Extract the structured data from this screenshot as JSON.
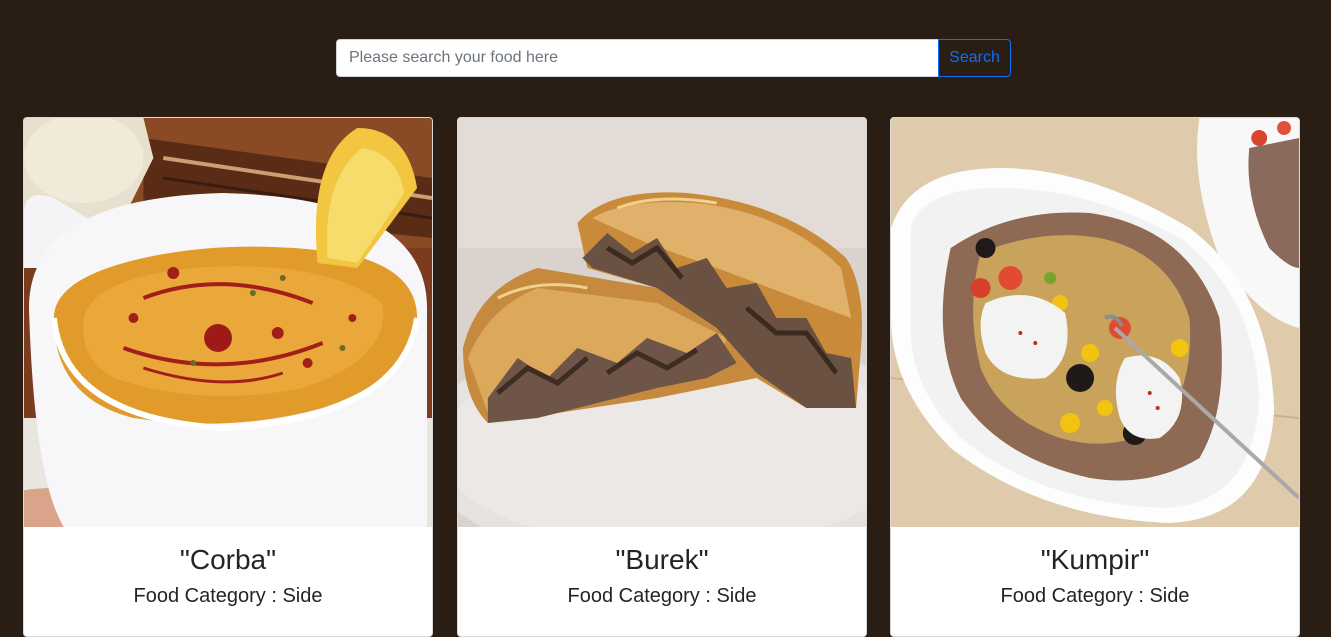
{
  "search": {
    "placeholder": "Please search your food here",
    "value": "",
    "button_label": "Search"
  },
  "colors": {
    "background": "#2a1d13",
    "accent": "#0d6efd",
    "card_background": "#ffffff",
    "text": "#212529"
  },
  "foods": [
    {
      "title": "\"Corba\"",
      "category": "Food Category : Side",
      "image": "lentil-soup-bowl"
    },
    {
      "title": "\"Burek\"",
      "category": "Food Category : Side",
      "image": "meat-burek-pastry"
    },
    {
      "title": "\"Kumpir\"",
      "category": "Food Category : Side",
      "image": "stuffed-baked-potato"
    }
  ]
}
